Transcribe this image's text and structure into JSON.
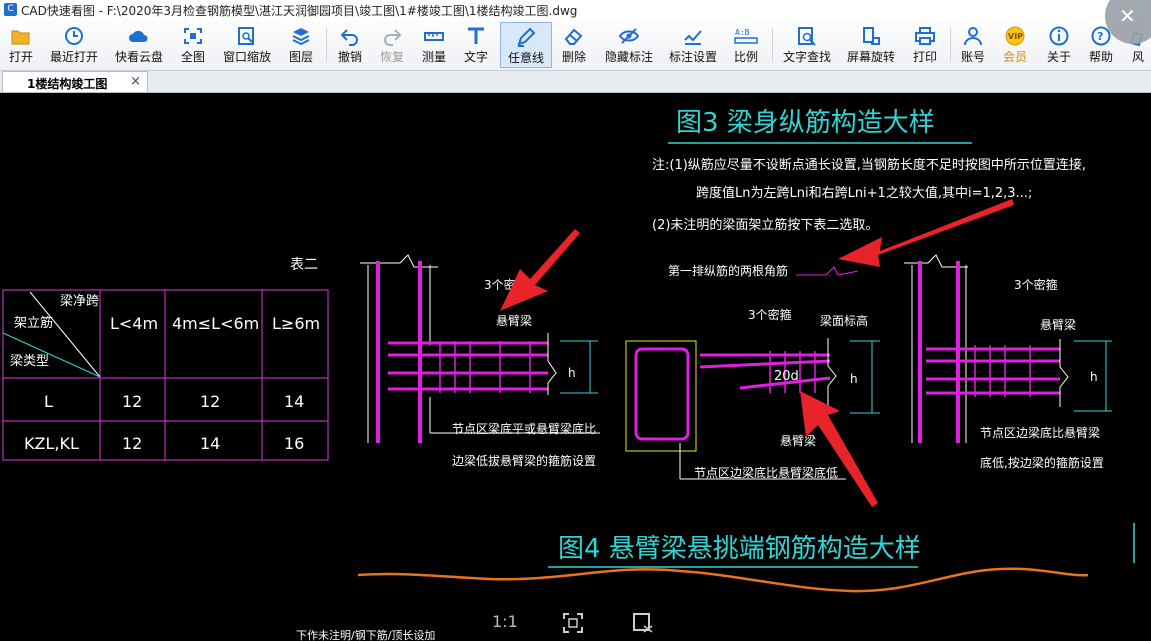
{
  "window": {
    "title": "CAD快速看图 - F:\\2020年3月检查钢筋模型\\湛江天润御园项目\\竣工图\\1#楼竣工图\\1楼结构竣工图.dwg"
  },
  "toolbar": {
    "items": [
      {
        "label": "打开",
        "icon": "folder-open-icon"
      },
      {
        "label": "最近打开",
        "icon": "clock-icon"
      },
      {
        "label": "快看云盘",
        "icon": "cloud-icon"
      },
      {
        "label": "全图",
        "icon": "fit-all-icon"
      },
      {
        "label": "窗口缩放",
        "icon": "window-zoom-icon"
      },
      {
        "label": "图层",
        "icon": "layers-icon"
      },
      {
        "label": "撤销",
        "icon": "undo-icon"
      },
      {
        "label": "恢复",
        "icon": "redo-icon"
      },
      {
        "label": "测量",
        "icon": "ruler-icon"
      },
      {
        "label": "文字",
        "icon": "text-icon"
      },
      {
        "label": "任意线",
        "icon": "pen-icon"
      },
      {
        "label": "删除",
        "icon": "eraser-icon"
      },
      {
        "label": "隐藏标注",
        "icon": "eye-hide-icon"
      },
      {
        "label": "标注设置",
        "icon": "annotation-settings-icon"
      },
      {
        "label": "比例",
        "icon": "scale-icon"
      },
      {
        "label": "文字查找",
        "icon": "text-search-icon"
      },
      {
        "label": "屏幕旋转",
        "icon": "rotate-screen-icon"
      },
      {
        "label": "打印",
        "icon": "printer-icon"
      },
      {
        "label": "账号",
        "icon": "user-icon"
      },
      {
        "label": "会员",
        "icon": "vip-icon"
      },
      {
        "label": "关于",
        "icon": "info-icon"
      },
      {
        "label": "帮助",
        "icon": "help-icon"
      },
      {
        "label": "风",
        "icon": "style-icon"
      }
    ]
  },
  "tabs": [
    {
      "label": "1楼结构竣工图",
      "close": "×"
    }
  ],
  "drawing": {
    "fig3_title": "图3   梁身纵筋构造大样",
    "note1": "注:(1)纵筋应尽量不设断点通长设置,当钢筋长度不足时按图中所示位置连接,",
    "note2": "跨度值Ln为左跨Lni和右跨Lni+1之较大值,其中i=1,2,3...;",
    "note3": "(2)未注明的梁面架立筋按下表二选取。",
    "table_title": "表二",
    "table": {
      "corner_top": "梁净跨",
      "corner_mid": "架立筋",
      "corner_bottom": "梁类型",
      "headers": [
        "L<4m",
        "4m≤L<6m",
        "L≥6m"
      ],
      "rows": [
        {
          "type": "L",
          "cells": [
            "12",
            "12",
            "14"
          ]
        },
        {
          "type": "KZL,KL",
          "cells": [
            "12",
            "14",
            "16"
          ]
        }
      ]
    },
    "labels": {
      "stirrups_left": "3个密箍",
      "cantilever_left": "悬臂梁",
      "node_left_1": "节点区梁底平或悬臂梁底比",
      "node_left_2": "边梁低拔悬臂梁的箍筋设置",
      "first_row": "第一排纵筋的两根角筋",
      "stirrups_mid": "3个密箍",
      "beam_top_elev": "梁面标高",
      "dim_20d": "20d",
      "cantilever_mid": "悬臂梁",
      "node_mid": "节点区边梁底比悬臂梁底低",
      "stirrups_right": "3个密箍",
      "cantilever_right": "悬臂梁",
      "node_right_1": "节点区边梁底比悬臂梁",
      "node_right_2": "底低,按边梁的箍筋设置",
      "dim_h": "h"
    },
    "fig4_title": "图4   悬臂梁悬挑端钢筋构造大样",
    "bottom_text": "下作未注明/钢下筋/顶长设加"
  },
  "bottom_controls": {
    "ratio": "1:1"
  }
}
